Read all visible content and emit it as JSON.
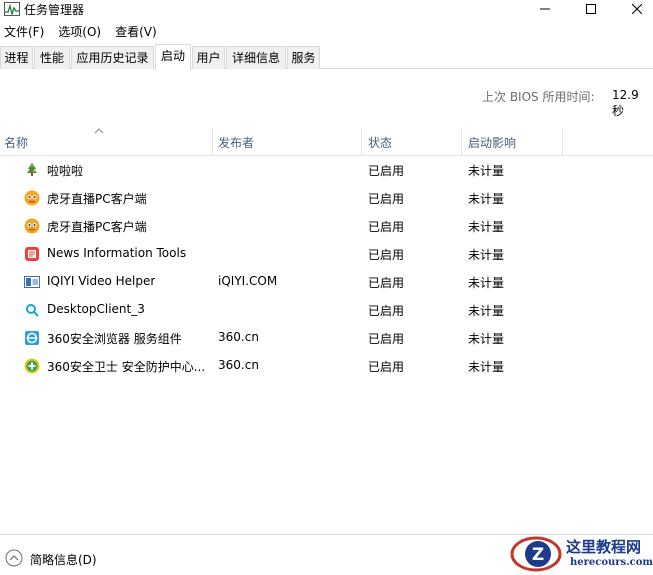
{
  "window": {
    "title": "任务管理器",
    "minimize_glyph": "—",
    "maximize_glyph": "☐",
    "close_glyph": "✕"
  },
  "menu": {
    "items": [
      "文件(F)",
      "选项(O)",
      "查看(V)"
    ]
  },
  "tabs": [
    {
      "label": "进程"
    },
    {
      "label": "性能"
    },
    {
      "label": "应用历史记录"
    },
    {
      "label": "启动",
      "active": true
    },
    {
      "label": "用户"
    },
    {
      "label": "详细信息"
    },
    {
      "label": "服务"
    }
  ],
  "boot": {
    "label": "上次 BIOS 所用时间:",
    "value": "12.9 秒"
  },
  "columns": {
    "name": "名称",
    "publisher": "发布者",
    "status": "状态",
    "impact": "启动影响"
  },
  "rows": [
    {
      "icon": "tree-icon",
      "name": "啦啦啦",
      "publisher": "",
      "status": "已启用",
      "impact": "未计量"
    },
    {
      "icon": "huya-icon",
      "name": "虎牙直播PC客户端",
      "publisher": "",
      "status": "已启用",
      "impact": "未计量"
    },
    {
      "icon": "huya-icon",
      "name": "虎牙直播PC客户端",
      "publisher": "",
      "status": "已启用",
      "impact": "未计量"
    },
    {
      "icon": "news-icon",
      "name": "News Information Tools",
      "publisher": "",
      "status": "已启用",
      "impact": "未计量"
    },
    {
      "icon": "iqiyi-icon",
      "name": "IQIYI Video Helper",
      "publisher": "iQIYI.COM",
      "status": "已启用",
      "impact": "未计量"
    },
    {
      "icon": "desktop-client-icon",
      "name": "DesktopClient_3",
      "publisher": "",
      "status": "已启用",
      "impact": "未计量"
    },
    {
      "icon": "360-browser-icon",
      "name": "360安全浏览器 服务组件",
      "publisher": "360.cn",
      "status": "已启用",
      "impact": "未计量"
    },
    {
      "icon": "360-guard-icon",
      "name": "360安全卫士 安全防护中心...",
      "publisher": "360.cn",
      "status": "已启用",
      "impact": "未计量"
    }
  ],
  "footer": {
    "label": "简略信息(D)"
  },
  "watermark": {
    "title": "这里教程网",
    "subtitle": "herecours.com",
    "logo_letter": "Z"
  },
  "colors": {
    "header_text": "#4c607a",
    "secondary_text": "#6d6d6d",
    "border": "#d9d9d9"
  }
}
